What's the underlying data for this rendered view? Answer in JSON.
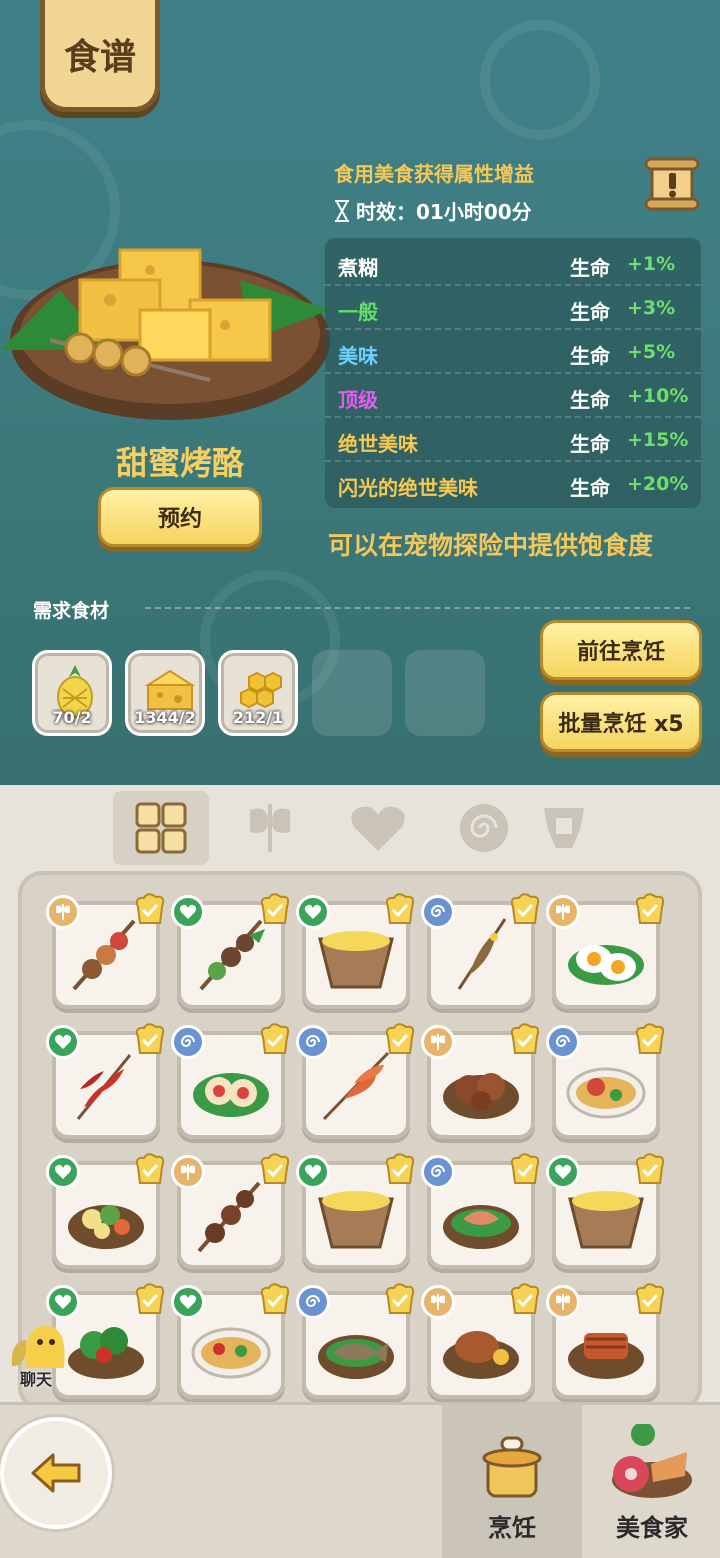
{
  "header": {
    "title": "食谱"
  },
  "dish": {
    "name": "甜蜜烤酪",
    "reserve_label": "预约"
  },
  "effect": {
    "title": "食用美食获得属性增益",
    "duration": "时效：01小时00分"
  },
  "quality_table": [
    {
      "quality": "煮糊",
      "stat": "生命",
      "bonus": "+1%",
      "color": "#ffffff"
    },
    {
      "quality": "一般",
      "stat": "生命",
      "bonus": "+3%",
      "color": "#5ee069"
    },
    {
      "quality": "美味",
      "stat": "生命",
      "bonus": "+5%",
      "color": "#6fd0ff"
    },
    {
      "quality": "顶级",
      "stat": "生命",
      "bonus": "+10%",
      "color": "#e55cf0"
    },
    {
      "quality": "绝世美味",
      "stat": "生命",
      "bonus": "+15%",
      "color": "#f6c853"
    },
    {
      "quality": "闪光的绝世美味",
      "stat": "生命",
      "bonus": "+20%",
      "color": "#f6c853"
    }
  ],
  "pet_note": "可以在宠物探险中提供饱食度",
  "ingredients": {
    "label": "需求食材",
    "items": [
      {
        "icon": "pineapple-icon",
        "count": "70/2"
      },
      {
        "icon": "cheese-icon",
        "count": "1344/2"
      },
      {
        "icon": "honeycomb-icon",
        "count": "212/1"
      }
    ]
  },
  "actions": {
    "go_cook": "前往烹饪",
    "batch_cook": "批量烹饪 x5"
  },
  "category_tabs": [
    "grid-icon",
    "axe-icon",
    "heart-icon",
    "spiral-icon",
    "armor-icon"
  ],
  "recipes": [
    {
      "badge": "axe",
      "food": "mushroom-skewer",
      "mastered": true
    },
    {
      "badge": "heart",
      "food": "veggie-skewer",
      "mastered": true
    },
    {
      "badge": "heart",
      "food": "soup-bowl",
      "mastered": true
    },
    {
      "badge": "spiral",
      "food": "fish-skewer",
      "mastered": true
    },
    {
      "badge": "axe",
      "food": "fried-eggs",
      "mastered": true
    },
    {
      "badge": "heart",
      "food": "pepper-skewer",
      "mastered": true
    },
    {
      "badge": "spiral",
      "food": "scallop-plate",
      "mastered": true
    },
    {
      "badge": "spiral",
      "food": "shrimp-skewer",
      "mastered": true
    },
    {
      "badge": "axe",
      "food": "meat-plate",
      "mastered": true
    },
    {
      "badge": "spiral",
      "food": "crab-soup",
      "mastered": true
    },
    {
      "badge": "heart",
      "food": "salad-bowl",
      "mastered": true
    },
    {
      "badge": "axe",
      "food": "meat-skewer",
      "mastered": true
    },
    {
      "badge": "heart",
      "food": "soup-bowl",
      "mastered": true
    },
    {
      "badge": "spiral",
      "food": "seafood-plate",
      "mastered": true
    },
    {
      "badge": "heart",
      "food": "soup-bowl",
      "mastered": true
    },
    {
      "badge": "heart",
      "food": "green-salad",
      "mastered": true
    },
    {
      "badge": "heart",
      "food": "curry-bowl",
      "mastered": true
    },
    {
      "badge": "spiral",
      "food": "fish-plate",
      "mastered": true
    },
    {
      "badge": "axe",
      "food": "roast-plate",
      "mastered": true
    },
    {
      "badge": "axe",
      "food": "bbq-plate",
      "mastered": true
    }
  ],
  "chat": {
    "label": "聊天"
  },
  "footer": {
    "cook_label": "烹饪",
    "gourmet_label": "美食家"
  }
}
